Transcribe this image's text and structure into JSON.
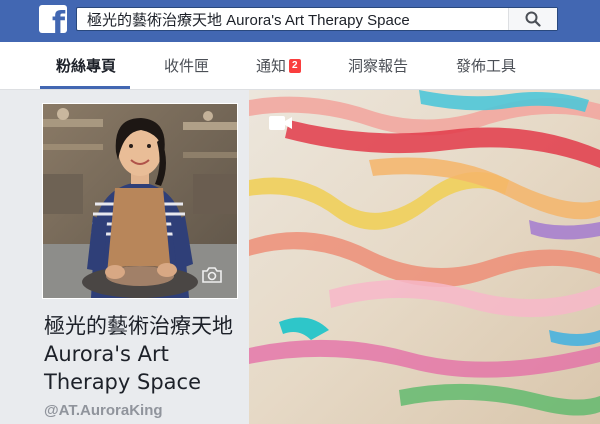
{
  "topbar": {
    "logo_glyph": "f",
    "search_value": "極光的藝術治療天地 Aurora's Art Therapy Space",
    "search_icon": "search-icon"
  },
  "tabs": [
    {
      "label": "粉絲專頁",
      "active": true
    },
    {
      "label": "收件匣",
      "active": false
    },
    {
      "label": "通知",
      "badge": "2",
      "active": false
    },
    {
      "label": "洞察報告",
      "active": false
    },
    {
      "label": "發佈工具",
      "active": false
    }
  ],
  "profile": {
    "name": "極光的藝術治療天地 Aurora's Art Therapy Space",
    "handle": "@AT.AuroraKing",
    "camera_icon": "camera-icon"
  },
  "cover": {
    "video_icon": "video-camera-icon"
  },
  "colors": {
    "brand_blue": "#4267b2",
    "badge_red": "#fa3e3e",
    "page_bg": "#e9ebee"
  }
}
